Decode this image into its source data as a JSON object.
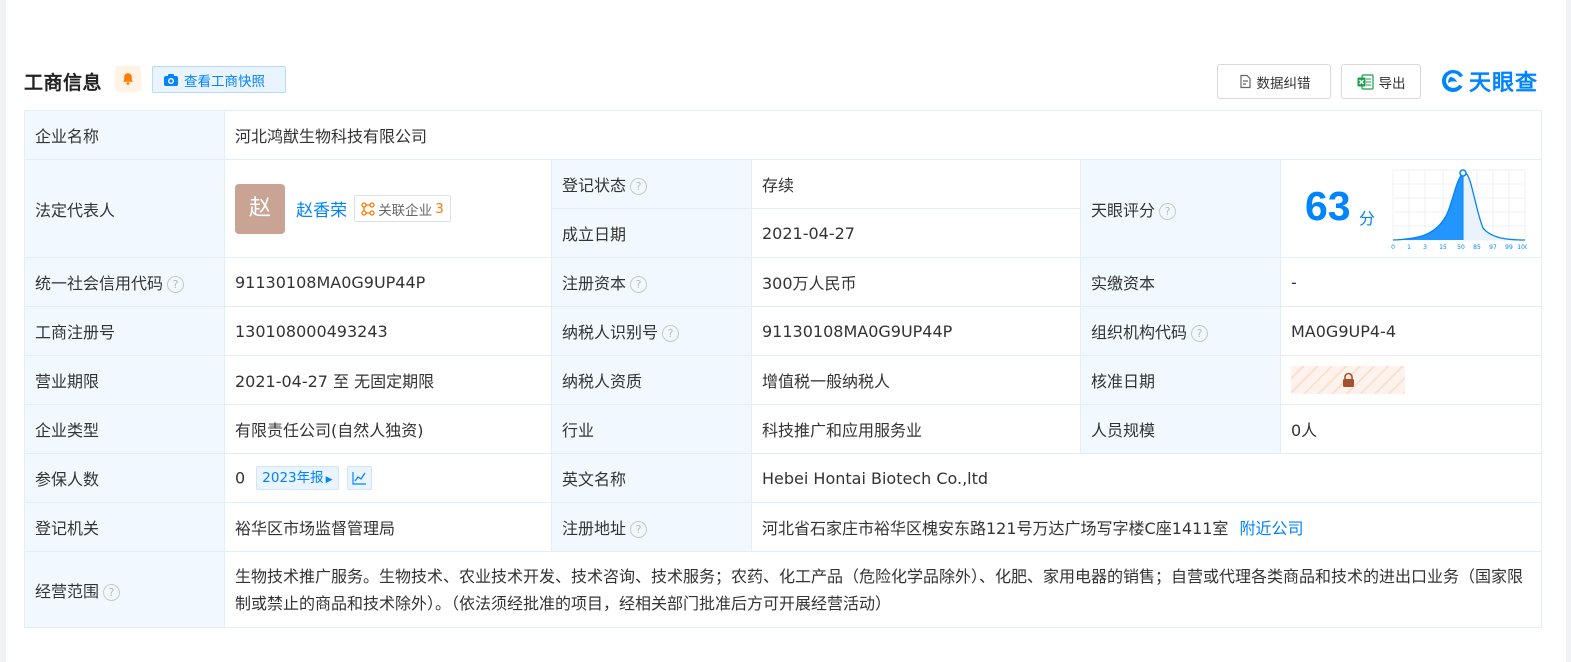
{
  "header": {
    "title": "工商信息",
    "snapshot_button": "查看工商快照",
    "correct_button": "数据纠错",
    "export_button": "导出",
    "logo_text": "天眼查"
  },
  "company": {
    "name_label": "企业名称",
    "name": "河北鸿猷生物科技有限公司",
    "legal_rep_label": "法定代表人",
    "legal_rep_avatar": "赵",
    "legal_rep_name": "赵香荣",
    "related_label": "关联企业",
    "related_count": "3",
    "status_label": "登记状态",
    "status": "存续",
    "founded_label": "成立日期",
    "founded": "2021-04-27",
    "score_label": "天眼评分",
    "score": "63",
    "score_unit": "分",
    "score_axis_ticks": [
      "0",
      "1",
      "3",
      "15",
      "50",
      "85",
      "97",
      "99",
      "100"
    ],
    "credit_code_label": "统一社会信用代码",
    "credit_code": "91130108MA0G9UP44P",
    "reg_capital_label": "注册资本",
    "reg_capital": "300万人民币",
    "paid_capital_label": "实缴资本",
    "paid_capital": "-",
    "reg_no_label": "工商注册号",
    "reg_no": "130108000493243",
    "taxpayer_id_label": "纳税人识别号",
    "taxpayer_id": "91130108MA0G9UP44P",
    "org_code_label": "组织机构代码",
    "org_code": "MA0G9UP4-4",
    "term_label": "营业期限",
    "term": "2021-04-27 至 无固定期限",
    "taxpayer_qual_label": "纳税人资质",
    "taxpayer_qual": "增值税一般纳税人",
    "approval_date_label": "核准日期",
    "type_label": "企业类型",
    "type": "有限责任公司(自然人独资)",
    "industry_label": "行业",
    "industry": "科技推广和应用服务业",
    "staff_label": "人员规模",
    "staff": "0人",
    "insured_label": "参保人数",
    "insured": "0",
    "report_year": "2023年报",
    "en_name_label": "英文名称",
    "en_name": "Hebei Hontai Biotech Co.,ltd",
    "authority_label": "登记机关",
    "authority": "裕华区市场监督管理局",
    "address_label": "注册地址",
    "address": "河北省石家庄市裕华区槐安东路121号万达广场写字楼C座1411室",
    "nearby_link": "附近公司",
    "scope_label": "经营范围",
    "scope": "生物技术推广服务。生物技术、农业技术开发、技术咨询、技术服务；农药、化工产品（危险化学品除外）、化肥、家用电器的销售；自营或代理各类商品和技术的进出口业务（国家限制或禁止的商品和技术除外）。（依法须经批准的项目，经相关部门批准后方可开展经营活动）"
  },
  "colors": {
    "accent": "#0084ff",
    "status_green": "#1ea96b",
    "label_bg": "#f2f9fe",
    "related_count": "#ff7a00"
  }
}
